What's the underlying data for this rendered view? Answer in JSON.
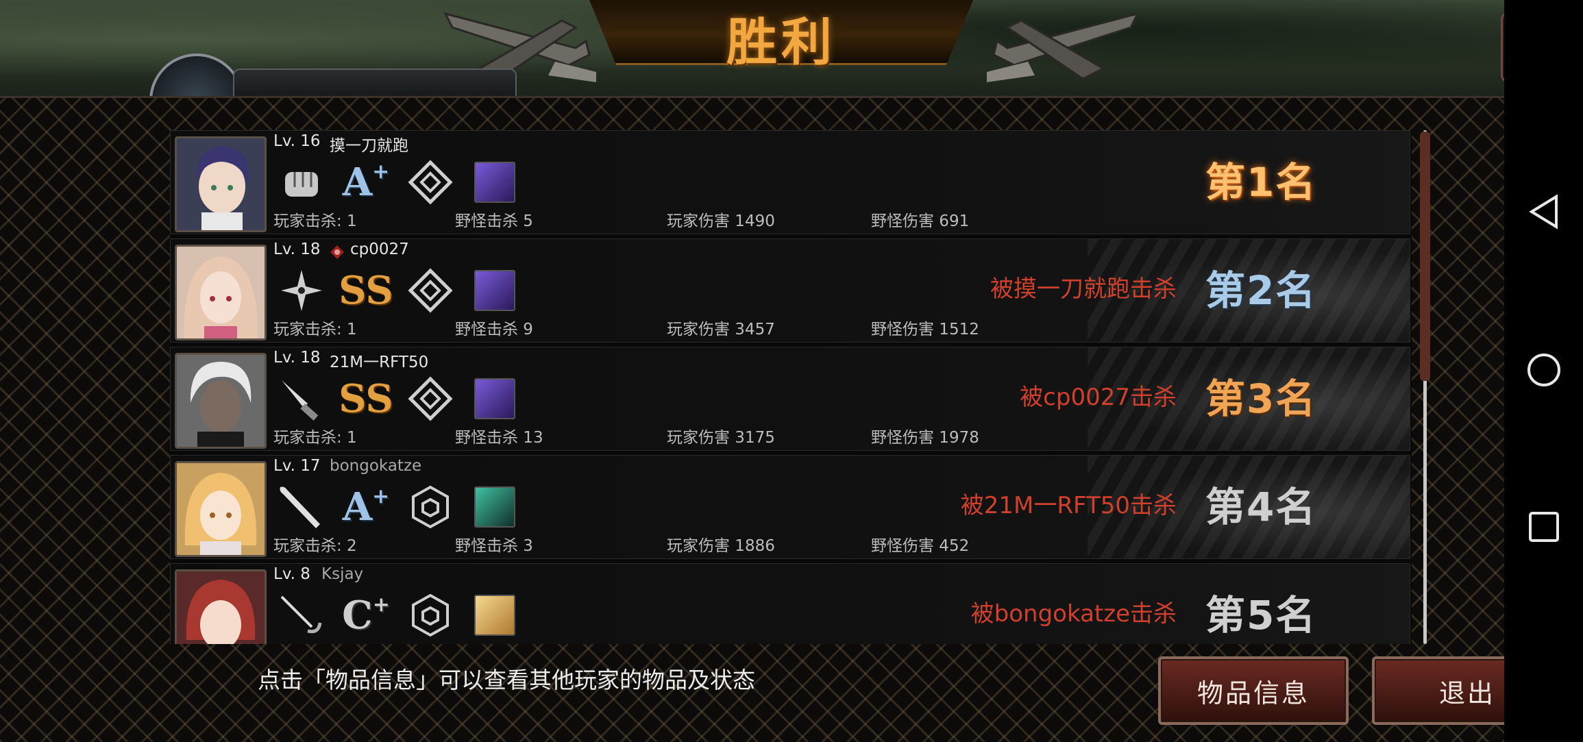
{
  "header": {
    "title": "胜利"
  },
  "players": [
    {
      "level": "Lv. 16",
      "name": "摸一刀就跑",
      "weapon_icon": "fist-icon",
      "grade": "A",
      "grade_sup": "+",
      "grade_style": "a",
      "player_kills": "玩家击杀: 1",
      "monster_kills": "野怪击杀 5",
      "player_damage": "玩家伤害 1490",
      "monster_damage": "野怪伤害 691",
      "killed_by": "",
      "rank": "第1名",
      "rank_style": "1",
      "emblem": "diamond",
      "item_color": "#5a3aa8"
    },
    {
      "level": "Lv. 18",
      "name": "cp0027",
      "weapon_icon": "shuriken-icon",
      "grade": "SS",
      "grade_sup": "",
      "grade_style": "ss",
      "player_kills": "玩家击杀: 1",
      "monster_kills": "野怪击杀 9",
      "player_damage": "玩家伤害 3457",
      "monster_damage": "野怪伤害 1512",
      "killed_by": "被摸一刀就跑击杀",
      "rank": "第2名",
      "rank_style": "2",
      "emblem": "diamond",
      "item_color": "#5a3aa8"
    },
    {
      "level": "Lv. 18",
      "name": "21M一RFT50",
      "weapon_icon": "knife-icon",
      "grade": "SS",
      "grade_sup": "",
      "grade_style": "ss",
      "player_kills": "玩家击杀: 1",
      "monster_kills": "野怪击杀 13",
      "player_damage": "玩家伤害 3175",
      "monster_damage": "野怪伤害 1978",
      "killed_by": "被cp0027击杀",
      "rank": "第3名",
      "rank_style": "3",
      "emblem": "diamond",
      "item_color": "#5a3aa8"
    },
    {
      "level": "Lv. 17",
      "name": "bongokatze",
      "weapon_icon": "bat-icon",
      "grade": "A",
      "grade_sup": "+",
      "grade_style": "a",
      "player_kills": "玩家击杀: 2",
      "monster_kills": "野怪击杀 3",
      "player_damage": "玩家伤害 1886",
      "monster_damage": "野怪伤害 452",
      "killed_by": "被21M一RFT50击杀",
      "rank": "第4名",
      "rank_style": "4",
      "emblem": "hexagon",
      "item_color": "#2a8a7a"
    },
    {
      "level": "Lv. 8",
      "name": "Ksjay",
      "weapon_icon": "rapier-icon",
      "grade": "C",
      "grade_sup": "+",
      "grade_style": "c",
      "player_kills": "",
      "monster_kills": "",
      "player_damage": "",
      "monster_damage": "",
      "killed_by": "被bongokatze击杀",
      "rank": "第5名",
      "rank_style": "5",
      "emblem": "hexagon",
      "item_color": "#e0b060"
    }
  ],
  "footer": {
    "hint": "点击「物品信息」可以查看其他玩家的物品及状态",
    "item_info_button": "物品信息",
    "exit_button": "退出"
  },
  "system_nav": {
    "back": "back-icon",
    "home": "home-icon",
    "recents": "recents-icon"
  }
}
